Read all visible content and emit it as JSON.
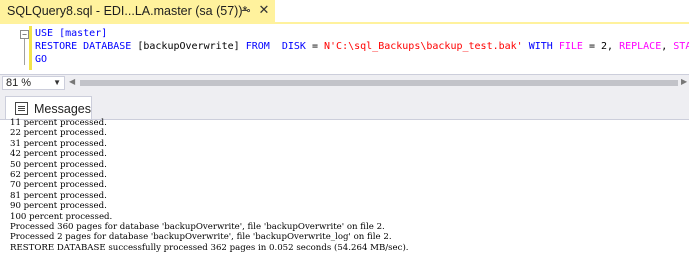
{
  "tab": {
    "title": "SQLQuery8.sql - EDI...LA.master (sa (57))*",
    "pin_icon": "pin-icon",
    "close_icon": "close-icon"
  },
  "editor": {
    "line1": "USE [master]",
    "line2_kw1": "RESTORE DATABASE",
    "line2_db": " [backupOverwrite] ",
    "line2_kw2": "FROM",
    "line2_sp1": "  ",
    "line2_kw3": "DISK",
    "line2_eq": " = ",
    "line2_path": "N'C:\\sql_Backups\\backup_test.bak'",
    "line2_sp2": " ",
    "line2_kw4": "WITH",
    "line2_sp3": " ",
    "line2_kw5": "FILE",
    "line2_val": " = 2, ",
    "line2_kw6": "REPLACE",
    "line2_comma": ", ",
    "line2_kw7": "STATS",
    "line3": "GO"
  },
  "zoom": {
    "value": "81 %"
  },
  "results": {
    "tab_label": "Messages",
    "icon": "messages-icon",
    "lines": [
      "11 percent processed.",
      "22 percent processed.",
      "31 percent processed.",
      "42 percent processed.",
      "50 percent processed.",
      "62 percent processed.",
      "70 percent processed.",
      "81 percent processed.",
      "90 percent processed.",
      "100 percent processed.",
      "Processed 360 pages for database 'backupOverwrite', file 'backupOverwrite' on file 2.",
      "Processed 2 pages for database 'backupOverwrite', file 'backupOverwrite_log' on file 2.",
      "RESTORE DATABASE successfully processed 362 pages in 0.052 seconds (54.264 MB/sec)."
    ]
  },
  "colors": {
    "tab_active": "#fff29d",
    "keyword": "#0000ff",
    "string": "#ff0000",
    "function": "#ff00ff"
  }
}
